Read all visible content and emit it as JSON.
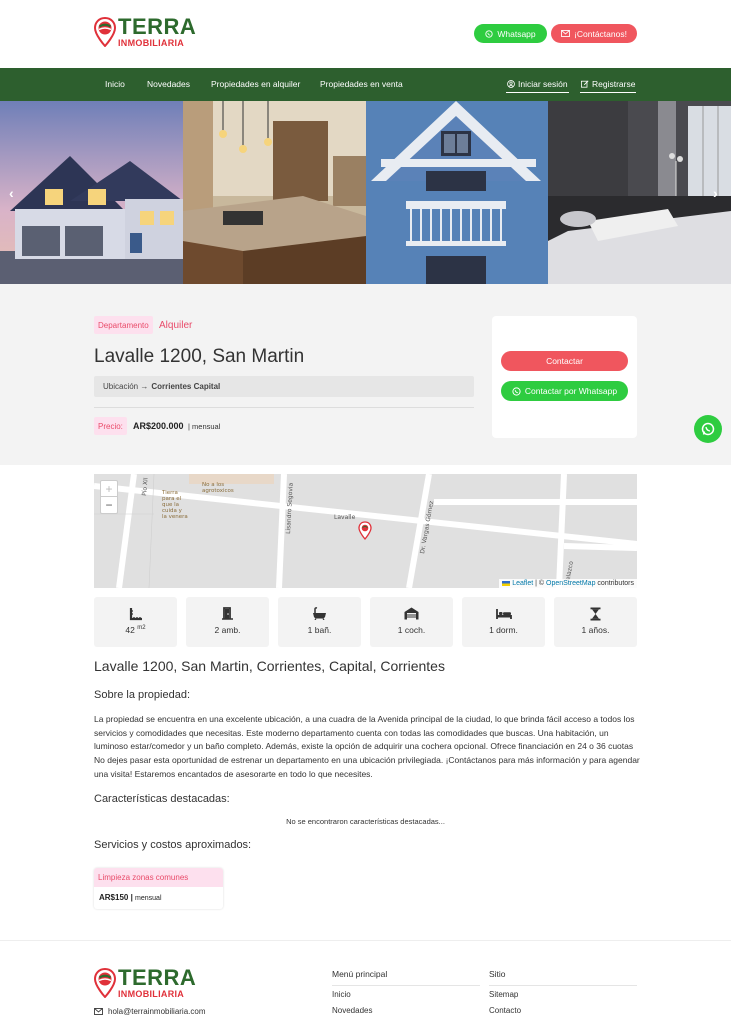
{
  "header": {
    "logo_main": "TERRA",
    "logo_sub": "INMOBILIARIA",
    "whatsapp_label": "Whatsapp",
    "contact_label": "¡Contáctanos!",
    "brand_green": "#2d6a2d",
    "brand_red": "#e0313a"
  },
  "nav": {
    "items": [
      "Inicio",
      "Novedades",
      "Propiedades en alquiler",
      "Propiedades en venta"
    ],
    "login": "Iniciar sesión",
    "register": "Registrarse"
  },
  "property": {
    "type": "Departamento",
    "operation": "Alquiler",
    "title": "Lavalle 1200, San Martin",
    "location_label": "Ubicación →",
    "location_value": "Corrientes Capital",
    "price_label": "Precio:",
    "price": "AR$200.000",
    "price_period": "mensual",
    "contact_button": "Contactar",
    "contact_whatsapp_button": "Contactar por Whatsapp"
  },
  "map": {
    "street_labels": [
      "Pío XII",
      "Lisandro Segovia",
      "Lavalle",
      "Dr. Vargas Gómez",
      "Velazco"
    ],
    "poi": "No a los agrotoxicos",
    "poi2": "Tierra para el que la cuida y la venera",
    "zoom_in": "+",
    "zoom_out": "−",
    "attribution_leaflet": "Leaflet",
    "attribution_sep": "| ©",
    "attribution_osm": "OpenStreetMap",
    "attribution_tail": "contributors"
  },
  "features": [
    {
      "icon": "area-icon",
      "value": "42",
      "unit": "m2"
    },
    {
      "icon": "door-icon",
      "value": "2 amb."
    },
    {
      "icon": "bath-icon",
      "value": "1 bañ."
    },
    {
      "icon": "garage-icon",
      "value": "1 coch."
    },
    {
      "icon": "bed-icon",
      "value": "1 dorm."
    },
    {
      "icon": "hourglass-icon",
      "value": "1 años."
    }
  ],
  "details": {
    "address": "Lavalle 1200, San Martin, Corrientes, Capital, Corrientes",
    "about_title": "Sobre la propiedad:",
    "description": "La propiedad se encuentra en una excelente ubicación, a una cuadra de la Avenida principal de la ciudad, lo que brinda fácil acceso a todos los servicios y comodidades que necesitas. Este moderno departamento cuenta con todas las comodidades que buscas. Una habitación, un luminoso estar/comedor y un baño completo. Además, existe la opción de adquirir una cochera opcional. Ofrece financiación en 24 o 36 cuotas No dejes pasar esta oportunidad de estrenar un departamento en una ubicación privilegiada. ¡Contáctanos para más información y para agendar una visita! Estaremos encantados de asesorarte en todo lo que necesites.",
    "features_title": "Características destacadas:",
    "no_features": "No se encontraron características destacadas...",
    "services_title": "Servicios y costos aproximados:",
    "service_name": "Limpieza zonas comunes",
    "service_price": "AR$150",
    "service_period": "mensual"
  },
  "footer": {
    "email": "hola@terrainmobiliaria.com",
    "menu_title": "Menú principal",
    "menu_items": [
      "Inicio",
      "Novedades"
    ],
    "site_title": "Sitio",
    "site_items": [
      "Sitemap",
      "Contacto"
    ]
  }
}
